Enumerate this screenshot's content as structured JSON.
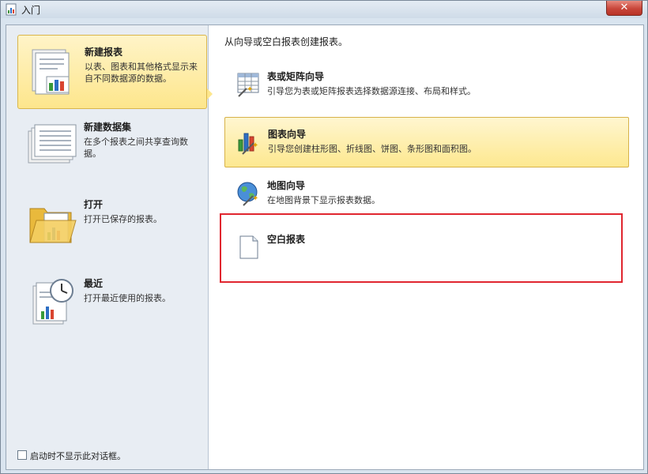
{
  "window": {
    "title": "入门",
    "close_label": "✕"
  },
  "nav": {
    "items": [
      {
        "title": "新建报表",
        "desc": "以表、图表和其他格式显示来自不同数据源的数据。",
        "selected": true
      },
      {
        "title": "新建数据集",
        "desc": "在多个报表之间共享查询数据。"
      },
      {
        "title": "打开",
        "desc": "打开已保存的报表。"
      },
      {
        "title": "最近",
        "desc": "打开最近使用的报表。"
      }
    ]
  },
  "options": {
    "dont_show_label": "启动时不显示此对话框。",
    "dont_show_checked": false
  },
  "main": {
    "instruction": "从向导或空白报表创建报表。",
    "wizards": [
      {
        "title": "表或矩阵向导",
        "desc": "引导您为表或矩阵报表选择数据源连接、布局和样式。"
      },
      {
        "title": "图表向导",
        "desc": "引导您创建柱形图、折线图、饼图、条形图和面积图。",
        "selected": true
      },
      {
        "title": "地图向导",
        "desc": "在地图背景下显示报表数据。"
      },
      {
        "title": "空白报表",
        "desc": ""
      }
    ]
  },
  "colors": {
    "highlight": "#e0262f",
    "selected_fill": "#fde68c",
    "panel": "#e8edf3"
  }
}
